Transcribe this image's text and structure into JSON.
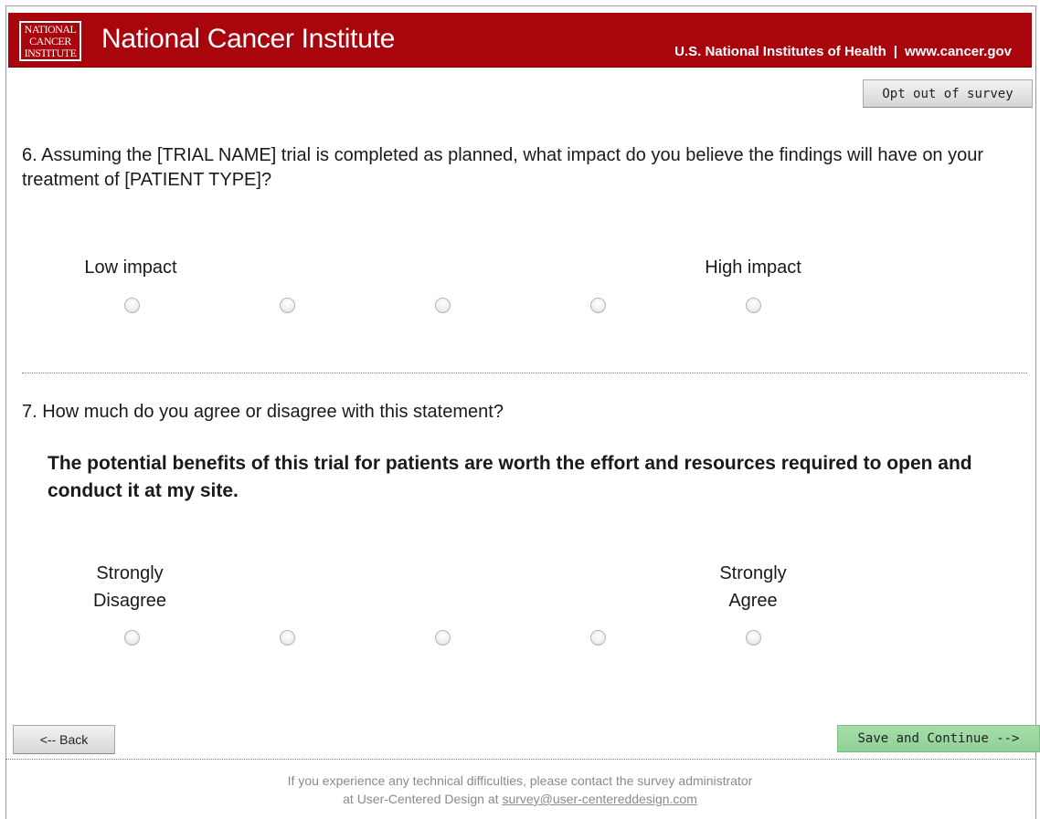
{
  "header": {
    "logo_lines": [
      "NATIONAL",
      "CANCER",
      "INSTITUTE"
    ],
    "title": "National Cancer Institute",
    "nih_text": "U.S. National Institutes of Health",
    "separator": "|",
    "nih_link": "www.cancer.gov"
  },
  "toolbar": {
    "opt_out_label": "Opt out of survey"
  },
  "question6": {
    "text": "6. Assuming the [TRIAL NAME] trial is completed as planned, what impact do you believe the findings will have on your treatment of [PATIENT TYPE]?",
    "low_label": "Low impact",
    "high_label": "High impact",
    "options_count": 5
  },
  "question7": {
    "text": "7. How much do you agree or disagree with this statement?",
    "statement": "The potential benefits of this trial for patients are worth the effort and resources required to open and conduct it at my site.",
    "low_label_line1": "Strongly",
    "low_label_line2": "Disagree",
    "high_label_line1": "Strongly",
    "high_label_line2": "Agree",
    "options_count": 5
  },
  "nav": {
    "back_label": "<-- Back",
    "save_label": "Save and Continue -->"
  },
  "footer": {
    "line1": "If you experience any technical difficulties, please contact the survey administrator",
    "line2_prefix": "at User-Centered Design at ",
    "email": "survey@user-centereddesign.com"
  },
  "colors": {
    "banner": "#a8050d",
    "save_button": "#98d59e",
    "footer_text": "#8a8a8a"
  }
}
